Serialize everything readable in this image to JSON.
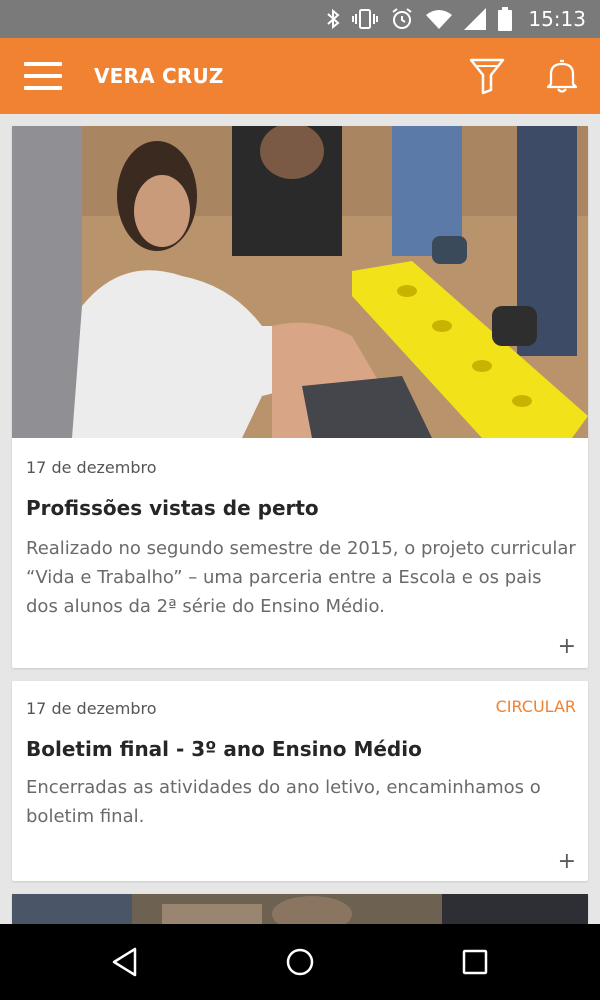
{
  "status_bar": {
    "time": "15:13",
    "icons": [
      "bluetooth-icon",
      "vibrate-icon",
      "alarm-icon",
      "wifi-icon",
      "signal-icon",
      "battery-icon"
    ]
  },
  "app_bar": {
    "title": "VERA CRUZ",
    "menu_icon": "hamburger-menu-icon",
    "filter_icon": "filter-icon",
    "notification_icon": "bell-icon"
  },
  "colors": {
    "accent": "#f08232",
    "status_bar": "#7a7a7a",
    "background": "#e6e6e6"
  },
  "feed": [
    {
      "date": "17 de dezembro",
      "tag": "",
      "title": "Profissões vistas de perto",
      "description": "Realizado no segundo semestre de 2015, o projeto curricular “Vida e Trabalho” – uma parceria entre a Escola e os pais dos alunos da 2ª série do Ensino Médio.",
      "expand": "+"
    },
    {
      "date": "17 de dezembro",
      "tag": "CIRCULAR",
      "title": "Boletim final - 3º ano Ensino Médio",
      "description": "Encerradas as atividades do ano letivo, encaminhamos  o boletim final.",
      "expand": "+"
    }
  ],
  "nav_bar": {
    "icons": [
      "back-icon",
      "home-icon",
      "recents-icon"
    ]
  }
}
